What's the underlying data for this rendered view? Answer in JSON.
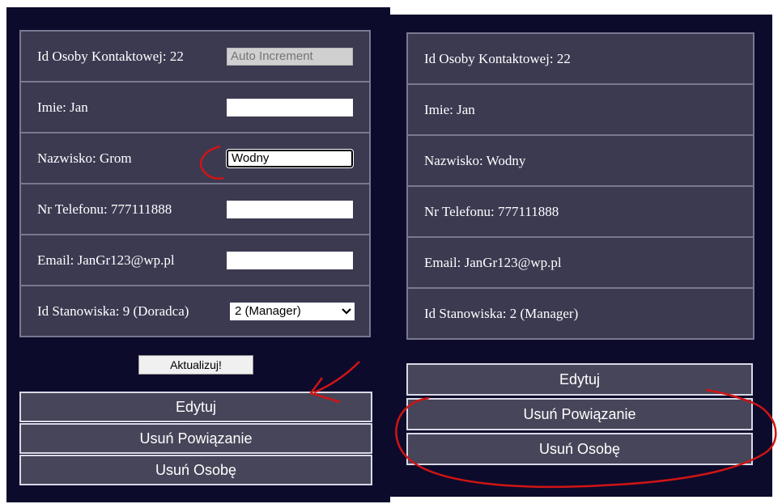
{
  "left_form": {
    "rows": [
      {
        "label": "Id Osoby Kontaktowej: 22",
        "placeholder": "Auto Increment"
      },
      {
        "label": "Imie: Jan",
        "value": ""
      },
      {
        "label": "Nazwisko: Grom",
        "value": "Wodny"
      },
      {
        "label": "Nr Telefonu: 777111888",
        "value": ""
      },
      {
        "label": "Email: JanGr123@wp.pl",
        "value": ""
      },
      {
        "label": "Id Stanowiska: 9 (Doradca)",
        "select_value": "2 (Manager)"
      }
    ],
    "update_button": "Aktualizuj!",
    "actions": {
      "edit": "Edytuj",
      "remove_link": "Usuń Powiązanie",
      "remove_person": "Usuń Osobę"
    }
  },
  "right_view": {
    "rows": [
      "Id Osoby Kontaktowej: 22",
      "Imie: Jan",
      "Nazwisko: Wodny",
      "Nr Telefonu: 777111888",
      "Email: JanGr123@wp.pl",
      "Id Stanowiska: 2 (Manager)"
    ],
    "actions": {
      "edit": "Edytuj",
      "remove_link": "Usuń Powiązanie",
      "remove_person": "Usuń Osobę"
    }
  },
  "colors": {
    "panel_bg": "#0c0b2c",
    "cell_bg": "#3c3a51",
    "annotation": "#d11414"
  },
  "icons": {
    "select_arrow": "chevron-down-icon"
  }
}
